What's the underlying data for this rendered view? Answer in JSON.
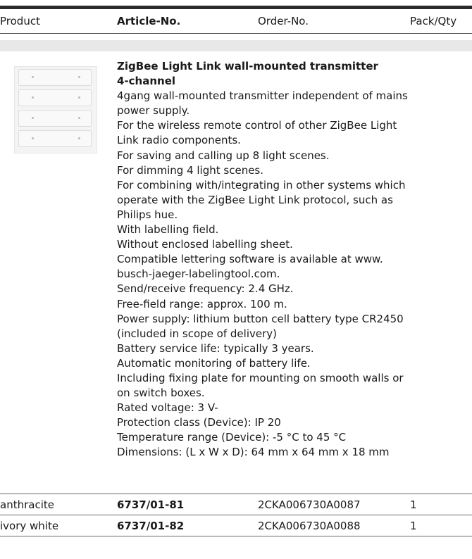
{
  "header": {
    "product": "Product",
    "article": "Article-No.",
    "order": "Order-No.",
    "pack": "Pack/Qty"
  },
  "item": {
    "title_lines": [
      "ZigBee Light Link wall-mounted transmitter",
      "4-channel"
    ],
    "description_lines": [
      "4gang wall-mounted transmitter independent of mains",
      "power supply.",
      "For the wireless remote control of other ZigBee Light",
      "Link radio components.",
      "For saving and calling up 8 light scenes.",
      "For dimming 4 light scenes.",
      "For combining with/integrating in other systems which",
      "operate with the ZigBee Light Link protocol, such as",
      "Philips hue.",
      "With labelling field.",
      "Without enclosed labelling sheet.",
      "Compatible lettering software is available at www.",
      "busch-jaeger-labelingtool.com.",
      "Send/receive frequency: 2.4 GHz.",
      "Free-field range: approx. 100 m.",
      "Power supply: lithium button cell battery type CR2450",
      "(included in scope of delivery)",
      "Battery service life: typically 3 years.",
      "Automatic monitoring of battery life.",
      "Including fixing plate for mounting on smooth walls or",
      "on switch boxes.",
      "Rated voltage: 3 V-",
      "Protection class (Device): IP 20",
      "Temperature range (Device): -5 °C to 45 °C",
      "Dimensions: (L x W x D): 64 mm x 64 mm x 18 mm"
    ]
  },
  "rows": [
    {
      "product": "anthracite",
      "article": "6737/01-81",
      "order": "2CKA006730A0087",
      "qty": "1"
    },
    {
      "product": "ivory white",
      "article": "6737/01-82",
      "order": "2CKA006730A0088",
      "qty": "1"
    }
  ]
}
